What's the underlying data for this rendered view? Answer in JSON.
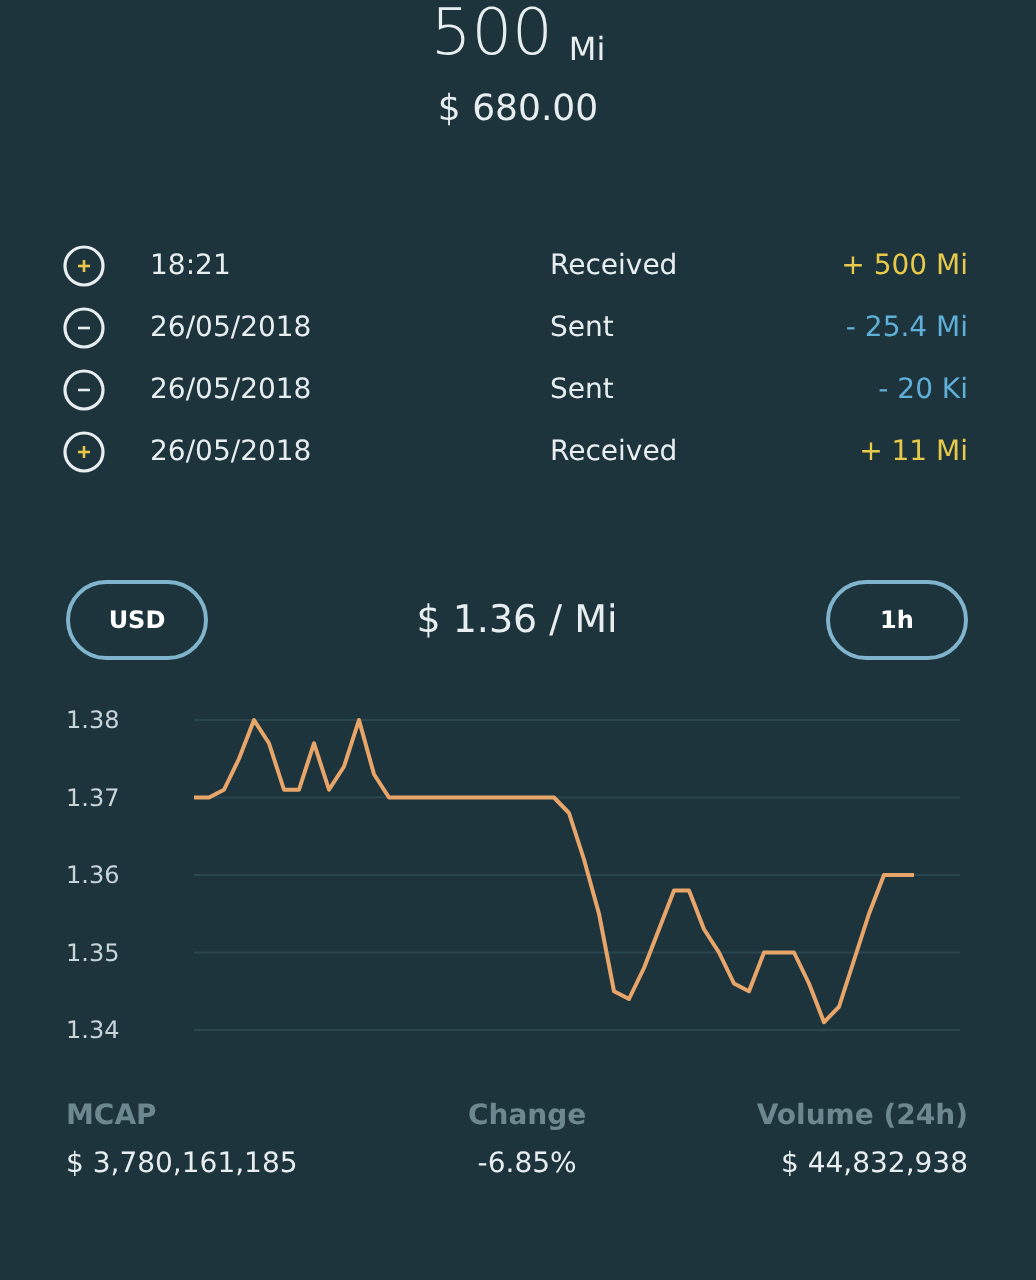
{
  "balance": {
    "amount": "500",
    "unit": "Mi",
    "fiat": "$ 680.00"
  },
  "transactions": [
    {
      "kind": "received",
      "time": "18:21",
      "label": "Received",
      "amount": "+ 500 Mi"
    },
    {
      "kind": "sent",
      "time": "26/05/2018",
      "label": "Sent",
      "amount": "- 25.4 Mi"
    },
    {
      "kind": "sent",
      "time": "26/05/2018",
      "label": "Sent",
      "amount": "- 20 Ki"
    },
    {
      "kind": "received",
      "time": "26/05/2018",
      "label": "Received",
      "amount": "+ 11 Mi"
    }
  ],
  "price_bar": {
    "currency_button": "USD",
    "price": "$ 1.36 / Mi",
    "interval_button": "1h"
  },
  "chart_data": {
    "type": "line",
    "categories": [
      null,
      null,
      null,
      null,
      null,
      null,
      null,
      null,
      null,
      null,
      null,
      null,
      null,
      null,
      null,
      null,
      null,
      null,
      null,
      null,
      null,
      null,
      null,
      null,
      null,
      null,
      null,
      null,
      null,
      null,
      null,
      null,
      null,
      null,
      null,
      null,
      null,
      null,
      null,
      null,
      null,
      null,
      null,
      null,
      null,
      null,
      null,
      null,
      null
    ],
    "ylim": [
      1.34,
      1.38
    ],
    "grid": true,
    "yticks": [
      {
        "value": 1.38,
        "label": "1.38"
      },
      {
        "value": 1.37,
        "label": "1.37"
      },
      {
        "value": 1.36,
        "label": "1.36"
      },
      {
        "value": 1.35,
        "label": "1.35"
      },
      {
        "value": 1.34,
        "label": "1.34"
      }
    ],
    "series": [
      {
        "color": "#e8a56a",
        "values": [
          1.37,
          1.37,
          1.371,
          1.375,
          1.38,
          1.377,
          1.371,
          1.371,
          1.377,
          1.371,
          1.374,
          1.38,
          1.373,
          1.37,
          1.37,
          1.37,
          1.37,
          1.37,
          1.37,
          1.37,
          1.37,
          1.37,
          1.37,
          1.37,
          1.37,
          1.368,
          1.362,
          1.355,
          1.345,
          1.344,
          1.348,
          1.353,
          1.358,
          1.358,
          1.353,
          1.35,
          1.346,
          1.345,
          1.35,
          1.35,
          1.35,
          1.346,
          1.341,
          1.343,
          1.349,
          1.355,
          1.36,
          1.36,
          1.36
        ]
      }
    ]
  },
  "stats": [
    {
      "label": "MCAP",
      "value": "$ 3,780,161,185"
    },
    {
      "label": "Change",
      "value": "-6.85%"
    },
    {
      "label": "Volume (24h)",
      "value": "$ 44,832,938"
    }
  ]
}
